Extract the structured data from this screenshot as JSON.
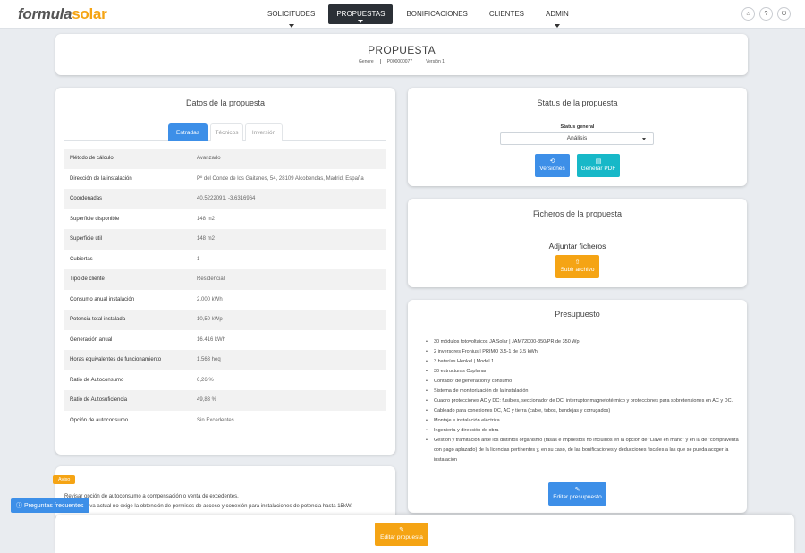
{
  "brand": {
    "part1": "formula",
    "part2": "solar"
  },
  "nav": {
    "items": [
      {
        "label": "SOLICITUDES"
      },
      {
        "label": "PROPUESTAS"
      },
      {
        "label": "BONIFICACIONES"
      },
      {
        "label": "CLIENTES"
      },
      {
        "label": "ADMIN"
      }
    ],
    "active_index": 1,
    "icons": [
      {
        "name": "home-icon",
        "glyph": "⌂"
      },
      {
        "name": "help-icon",
        "glyph": "?"
      },
      {
        "name": "power-icon",
        "glyph": "⏻"
      }
    ]
  },
  "header": {
    "title": "PROPUESTA",
    "meta": [
      "Genere",
      "P000000077",
      "Versión 1"
    ]
  },
  "datos": {
    "title": "Datos de la propuesta",
    "tabs": [
      "Entradas",
      "Técnicos",
      "Inversión"
    ],
    "rows": [
      {
        "label": "Método de cálculo",
        "value": "Avanzado"
      },
      {
        "label": "Dirección de la instalación",
        "value": "Pº del Conde de los Gaitanes, 54, 28109 Alcobendas, Madrid, España"
      },
      {
        "label": "Coordenadas",
        "value": "40.5222091, -3.6316964"
      },
      {
        "label": "Superficie disponible",
        "value": "148 m2"
      },
      {
        "label": "Superficie útil",
        "value": "148 m2"
      },
      {
        "label": "Cubiertas",
        "value": "1"
      },
      {
        "label": "Tipo de cliente",
        "value": "Residencial"
      },
      {
        "label": "Consumo anual instalación",
        "value": "2.000 kWh"
      },
      {
        "label": "Potencia total instalada",
        "value": "10,50 kWp"
      },
      {
        "label": "Generación anual",
        "value": "16.416 kWh"
      },
      {
        "label": "Horas equivalentes de funcionamiento",
        "value": "1.563 heq"
      },
      {
        "label": "Ratio de Autoconsumo",
        "value": "6,26 %"
      },
      {
        "label": "Ratio de Autosuficiencia",
        "value": "49,83 %"
      },
      {
        "label": "Opción de autoconsumo",
        "value": "Sin Excedentes"
      }
    ]
  },
  "status": {
    "title": "Status de la propuesta",
    "label": "Status general",
    "selected": "Análisis",
    "versiones_label": "Versiones",
    "pdf_label": "Generar PDF"
  },
  "ficheros": {
    "title": "Ficheros de la propuesta",
    "adjuntar": "Adjuntar ficheros",
    "subir_label": "Subir archivo"
  },
  "presupuesto": {
    "title": "Presupuesto",
    "items": [
      "30 módulos fotovoltaicos JA Solar | JAM72D00-350/PR de 350 Wp",
      "2 inversores Fronius | PRIMO 3.5-1 de 3.5 kWh",
      "3 baterías Henkel | Model 1",
      "30 estructuras Coplanar",
      "Contador de generación y consumo",
      "Sistema de monitorización de la instalación",
      "Cuadro protecciones AC y DC: fusibles, seccionador de DC, interruptor magnetotérmico y protecciones para sobretensiones en AC y DC.",
      "Cableado para conexiones DC, AC y tierra (cable, tubos, bandejas y corrugados)",
      "Montaje e instalación eléctrica",
      "Ingeniería y dirección de obra",
      "Gestión y tramitación ante los distintos organismo (tasas e impuestos no incluidos en la opción de \"Llave en mano\" y en la de \"compraventa con pago aplazado) de la licencias pertinentes y, en su caso, de las bonificaciones y deducciones fiscales a las que se pueda acoger la instalación"
    ],
    "edit_label": "Editar presupuesto"
  },
  "aviso": {
    "badge": "Aviso",
    "line1": "Revisar opción de autoconsumo a compensación o venta de excedentes.",
    "line2": "La normativa actual no exige la obtención de permisos de acceso y conexión para instalaciones de potencia hasta 15kW."
  },
  "faq_label": "Preguntas frecuentes",
  "edit_proposal_label": "Editar propuesta",
  "colors": {
    "blue": "#3d8fe8",
    "teal": "#17b8c8",
    "orange": "#f5a414",
    "dark_nav": "#2b3036"
  }
}
